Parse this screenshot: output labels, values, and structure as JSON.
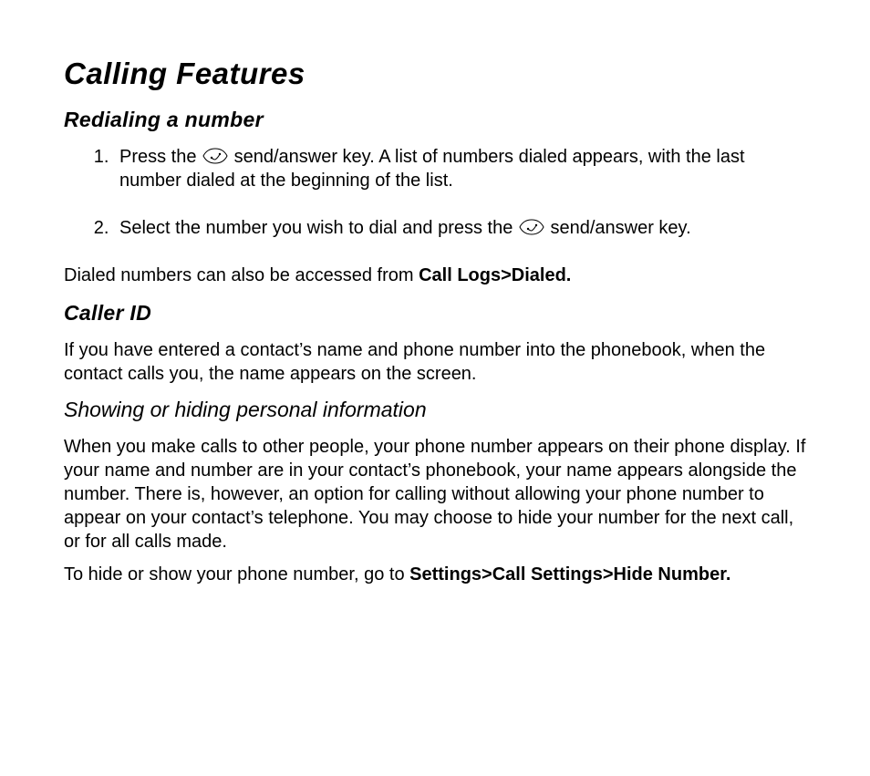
{
  "title": "Calling Features",
  "section1": {
    "heading": "Redialing a number",
    "step1a": "Press the ",
    "step1b": " send/answer key. A list of numbers dialed appears, with the last number dialed at the beginning of the list.",
    "step2a": "Select the number you wish to dial and press the ",
    "step2b": " send/answer key.",
    "note_prefix": "Dialed numbers can also be accessed from ",
    "note_menu": "Call Logs>Dialed."
  },
  "section2": {
    "heading": "Caller ID",
    "body": "If you have entered a contact’s name and phone number into the phonebook, when the contact calls you, the name appears on the screen."
  },
  "section3": {
    "heading": "Showing or hiding personal information",
    "body": "When you make calls to other people, your phone number appears on their phone display. If your name and number are in your contact’s phonebook, your name appears alongside the number. There is, however, an option for calling without allowing your phone number to appear on your contact’s telephone. You may choose to hide your number for the next call, or for all calls made.",
    "hide_prefix": "To hide or show your phone number, go to ",
    "hide_menu": "Settings>Call Settings>Hide Number."
  }
}
